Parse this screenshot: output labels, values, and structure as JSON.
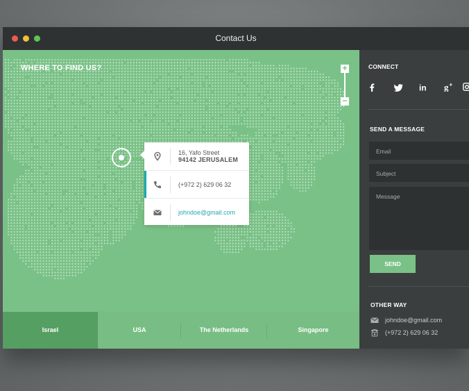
{
  "window": {
    "title": "Contact Us"
  },
  "map": {
    "heading": "WHERE TO FIND US?",
    "zoom_in": "+",
    "zoom_out": "−"
  },
  "contact_card": {
    "address_line1": "16, Yafo Street",
    "address_line2": "94142 JERUSALEM",
    "phone": "(+972 2) 629 06 32",
    "email": "johndoe@gmail.com",
    "icons": [
      "location-pin-icon",
      "phone-icon",
      "envelope-icon"
    ]
  },
  "tabs": [
    {
      "label": "Israel",
      "active": true
    },
    {
      "label": "USA",
      "active": false
    },
    {
      "label": "The Netherlands",
      "active": false
    },
    {
      "label": "Singapore",
      "active": false
    }
  ],
  "sidebar": {
    "connect_heading": "CONNECT",
    "social": [
      {
        "icon": "facebook-icon",
        "glyph": "f"
      },
      {
        "icon": "twitter-icon",
        "glyph": "t"
      },
      {
        "icon": "linkedin-icon",
        "glyph": "in"
      },
      {
        "icon": "google-plus-icon",
        "glyph": "g+"
      },
      {
        "icon": "instagram-icon",
        "glyph": "ig"
      }
    ],
    "send_heading": "SEND A MESSAGE",
    "email_placeholder": "Email",
    "subject_placeholder": "Subject",
    "message_placeholder": "Message",
    "send_label": "SEND",
    "other_heading": "OTHER WAY",
    "other_email": "johndoe@gmail.com",
    "other_phone": "(+972 2) 629 06 32"
  },
  "colors": {
    "map_green": "#7ac187",
    "active_tab": "#549f61",
    "accent_teal": "#1aa8b3",
    "sidebar_dark": "#3a3e3e",
    "field_dark": "#2d3131"
  }
}
